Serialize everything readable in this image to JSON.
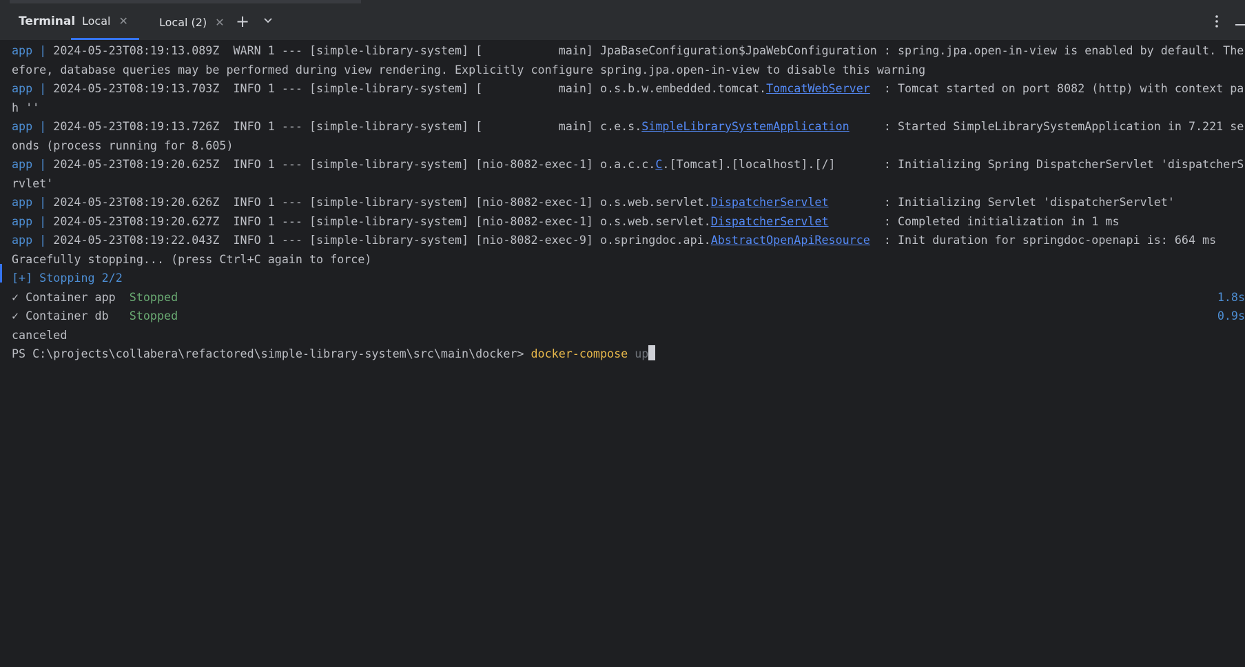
{
  "tabbar": {
    "title": "Terminal",
    "tabs": [
      {
        "label": "Local",
        "active": true
      },
      {
        "label": "Local (2)",
        "active": false
      }
    ],
    "accent": "#3574f0"
  },
  "console": {
    "prefix": "app",
    "sep": " | ",
    "lines": [
      {
        "a": "2024-05-23T08:19:13.089Z  WARN 1 --- [simple-library-system] [           main] JpaBaseConfiguration$JpaWebConfiguration : spring.jpa.open-in-view is enabled by default. The"
      },
      {
        "a": "efore, database queries may be performed during view rendering. Explicitly configure spring.jpa.open-in-view to disable this warning"
      },
      {
        "a": "2024-05-23T08:19:13.703Z  INFO 1 --- [simple-library-system] [           main] o.s.b.w.embedded.tomcat.",
        "link": "TomcatWebServer",
        "b": "  : Tomcat started on port 8082 (http) with context pa"
      },
      {
        "a": "h ''"
      },
      {
        "a": "2024-05-23T08:19:13.726Z  INFO 1 --- [simple-library-system] [           main] c.e.s.",
        "link": "SimpleLibrarySystemApplication",
        "b": "     : Started SimpleLibrarySystemApplication in 7.221 se"
      },
      {
        "a": "onds (process running for 8.605)"
      },
      {
        "a": "2024-05-23T08:19:20.625Z  INFO 1 --- [simple-library-system] [nio-8082-exec-1] o.a.c.c.",
        "link": "C",
        "b": ".[Tomcat].[localhost].[/]       : Initializing Spring DispatcherServlet 'dispatcherS"
      },
      {
        "a": "rvlet'"
      },
      {
        "a": "2024-05-23T08:19:20.626Z  INFO 1 --- [simple-library-system] [nio-8082-exec-1] o.s.web.servlet.",
        "link": "DispatcherServlet",
        "b": "        : Initializing Servlet 'dispatcherServlet'"
      },
      {
        "a": "2024-05-23T08:19:20.627Z  INFO 1 --- [simple-library-system] [nio-8082-exec-1] o.s.web.servlet.",
        "link": "DispatcherServlet",
        "b": "        : Completed initialization in 1 ms"
      },
      {
        "a": "2024-05-23T08:19:22.043Z  INFO 1 --- [simple-library-system] [nio-8082-exec-9] o.springdoc.api.",
        "link": "AbstractOpenApiResource",
        "b": "  : Init duration for springdoc-openapi is: 664 ms"
      }
    ],
    "graceful": "Gracefully stopping... (press Ctrl+C again to force)",
    "stopping": "[+] Stopping 2/2",
    "containers": [
      {
        "check": "✓",
        "name": "Container app",
        "status": "Stopped",
        "time": "1.8s"
      },
      {
        "check": "✓",
        "name": "Container db ",
        "status": "Stopped",
        "time": "0.9s"
      }
    ],
    "canceled": "canceled",
    "prompt": "PS C:\\projects\\collabera\\refactored\\simple-library-system\\src\\main\\docker>",
    "command": "docker-compose",
    "arg": "up"
  }
}
